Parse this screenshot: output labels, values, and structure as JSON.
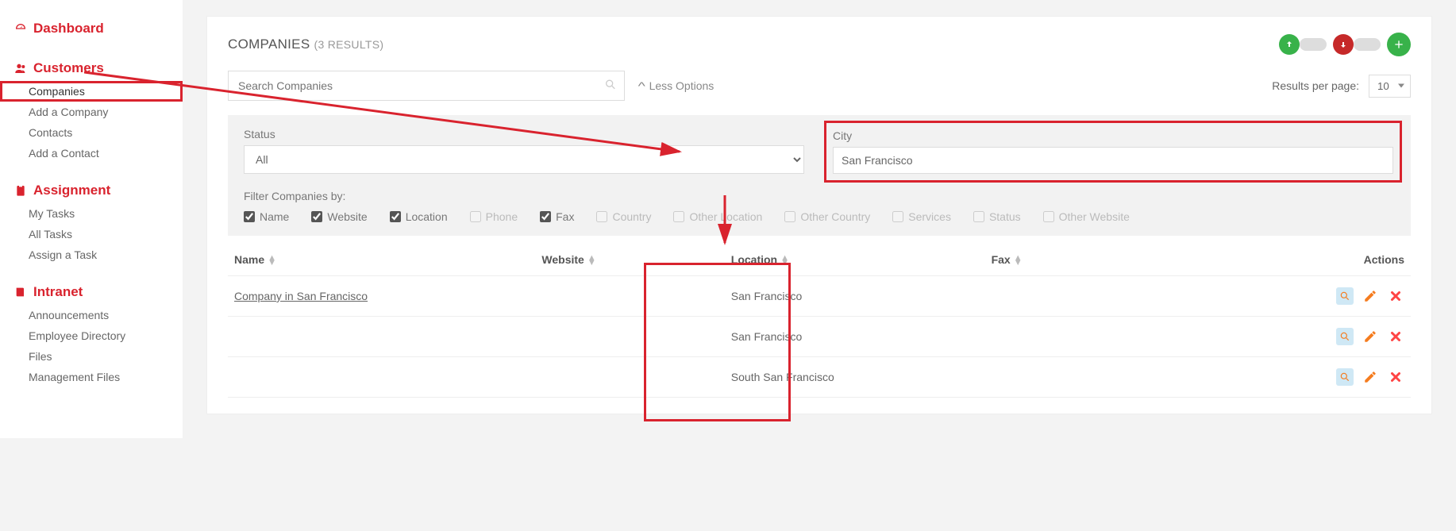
{
  "sidebar": {
    "sections": [
      {
        "title": "Dashboard",
        "icon": "gauge",
        "items": []
      },
      {
        "title": "Customers",
        "icon": "users",
        "items": [
          {
            "label": "Companies",
            "active": true
          },
          {
            "label": "Add a Company"
          },
          {
            "label": "Contacts"
          },
          {
            "label": "Add a Contact"
          }
        ]
      },
      {
        "title": "Assignment",
        "icon": "clipboard",
        "items": [
          {
            "label": "My Tasks"
          },
          {
            "label": "All Tasks"
          },
          {
            "label": "Assign a Task"
          }
        ]
      },
      {
        "title": "Intranet",
        "icon": "book",
        "items": [
          {
            "label": "Announcements"
          },
          {
            "label": "Employee Directory"
          },
          {
            "label": "Files"
          },
          {
            "label": "Management Files"
          }
        ]
      }
    ]
  },
  "page": {
    "title": "COMPANIES",
    "result_count_label": "(3 RESULTS)"
  },
  "search": {
    "placeholder": "Search Companies",
    "less_options": "Less Options",
    "results_per_page_label": "Results per page:",
    "results_per_page_value": "10"
  },
  "filters": {
    "status_label": "Status",
    "status_value": "All",
    "city_label": "City",
    "city_value": "San Francisco",
    "filter_by_label": "Filter Companies by:",
    "checks": [
      {
        "label": "Name",
        "checked": true,
        "enabled": true
      },
      {
        "label": "Website",
        "checked": true,
        "enabled": true
      },
      {
        "label": "Location",
        "checked": true,
        "enabled": true
      },
      {
        "label": "Phone",
        "checked": false,
        "enabled": false
      },
      {
        "label": "Fax",
        "checked": true,
        "enabled": true
      },
      {
        "label": "Country",
        "checked": false,
        "enabled": false
      },
      {
        "label": "Other Location",
        "checked": false,
        "enabled": false
      },
      {
        "label": "Other Country",
        "checked": false,
        "enabled": false
      },
      {
        "label": "Services",
        "checked": false,
        "enabled": false
      },
      {
        "label": "Status",
        "checked": false,
        "enabled": false
      },
      {
        "label": "Other Website",
        "checked": false,
        "enabled": false
      }
    ]
  },
  "table": {
    "columns": {
      "name": "Name",
      "website": "Website",
      "location": "Location",
      "fax": "Fax",
      "actions": "Actions"
    },
    "rows": [
      {
        "name": "Company in San Francisco",
        "website": "",
        "location": "San Francisco",
        "fax": ""
      },
      {
        "name": "",
        "website": "",
        "location": "San Francisco",
        "fax": ""
      },
      {
        "name": "",
        "website": "",
        "location": "South San Francisco",
        "fax": ""
      }
    ]
  },
  "colors": {
    "accent_red": "#d9232e",
    "accent_green": "#38b24a",
    "accent_orange": "#f57c1f"
  }
}
